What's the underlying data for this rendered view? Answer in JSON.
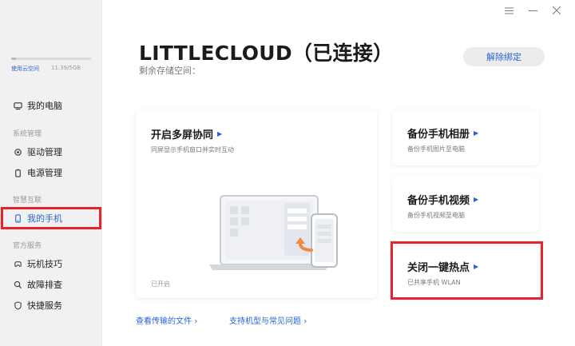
{
  "window": {
    "menu_icon": "menu-icon",
    "minimize_icon": "minimize-icon",
    "close_icon": "close-icon"
  },
  "sidebar": {
    "cloud": {
      "label": "使用云空间",
      "size": "11.39/5GB",
      "usage_fraction": 0.06
    },
    "my_pc": "我的电脑",
    "group_system": "系统管理",
    "driver": "驱动管理",
    "power": "电源管理",
    "group_smart": "智慧互联",
    "my_phone": "我的手机",
    "group_service": "官方服务",
    "tips": "玩机技巧",
    "troubleshoot": "故障排查",
    "quick_service": "快捷服务"
  },
  "header": {
    "device_title": "LITTLECLOUD（已连接）",
    "storage_label": "剩余存储空间：",
    "unbind_button": "解除绑定"
  },
  "multiscreen": {
    "title": "开启多屏协同",
    "subtitle": "同屏显示手机窗口并实时互动",
    "status": "已开启"
  },
  "cards": {
    "photos": {
      "title": "备份手机相册",
      "subtitle": "备份手机图片至电脑"
    },
    "videos": {
      "title": "备份手机视频",
      "subtitle": "备份手机视频至电脑"
    },
    "hotspot": {
      "title": "关闭一键热点",
      "subtitle": "已共享手机 WLAN"
    }
  },
  "footer": {
    "transferred_files": "查看传输的文件",
    "supported_models": "支持机型与常见问题"
  },
  "colors": {
    "accent": "#2a63d6",
    "highlight": "#e8232b",
    "sidebar_bg": "#f1f1f2"
  }
}
